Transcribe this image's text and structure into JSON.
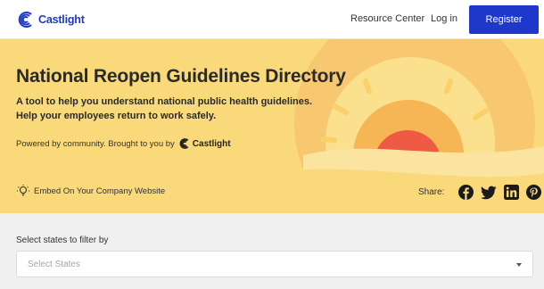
{
  "nav": {
    "brand": "Castlight",
    "links": [
      "Resource Center",
      "Log in"
    ],
    "register_label": "Register",
    "brand_color": "#1f38c9"
  },
  "hero": {
    "title": "National Reopen Guidelines Directory",
    "subtitle_line1": "A tool to help you understand national public health guidelines.",
    "subtitle_line2": "Help your employees return to work safely.",
    "powered_text": "Powered by community. Brought to you by",
    "powered_brand": "Castlight",
    "embed_label": "Embed On Your Company Website",
    "share_label": "Share:",
    "social_icons": [
      "facebook-icon",
      "twitter-icon",
      "linkedin-icon",
      "pinterest-icon"
    ],
    "background_color": "#f9d97a"
  },
  "filter": {
    "label": "Select states to filter by",
    "placeholder": "Select States"
  }
}
